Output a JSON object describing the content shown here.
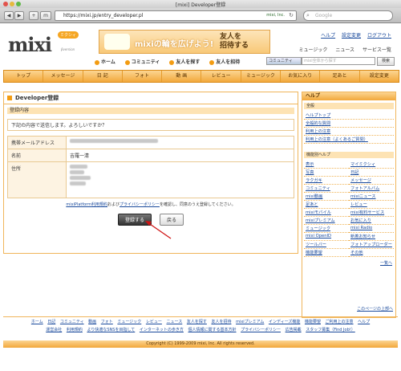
{
  "browser": {
    "title": "[mixi] Developer登録",
    "url": "https://mixi.jp/entry_developer.pl",
    "security": "mixi, Inc.",
    "search_placeholder": "Google"
  },
  "header": {
    "logo": "mixi",
    "logo_badge": "ミクシィ",
    "logo_beta": "βversion",
    "banner_text1": "mixiの輪を広げよう!",
    "banner_text2": "友人を\n招待する",
    "top_links": [
      "ヘルプ",
      "設定変更",
      "ログアウト"
    ],
    "services": [
      "ミュージック",
      "ニュース",
      "サービス一覧"
    ],
    "nav": [
      "ホーム",
      "コミュニティ",
      "友人を探す",
      "友人を招待"
    ],
    "community_select": "コミュニティ",
    "community_placeholder": "mixi全体から探す",
    "search_button": "検索"
  },
  "global_nav": [
    "トップ",
    "メッセージ",
    "日 記",
    "フォト",
    "動 画",
    "レビュー",
    "ミュージック",
    "お気に入り",
    "足あと",
    "設定変更"
  ],
  "main": {
    "title": "Developer登録",
    "section": "登録内容",
    "confirm": "下記の内容で送信します。よろしいですか？",
    "rows": [
      {
        "label": "携帯メールアドレス"
      },
      {
        "label": "名前",
        "value": "吉羅一清"
      },
      {
        "label": "住所"
      }
    ],
    "policy_link1": "mixiPlatform利用規約",
    "policy_mid": "および",
    "policy_link2": "プライバシーポリシー",
    "policy_tail": "を確認し、同意のうえ登録してください。",
    "register_button": "登録する",
    "back_button": "戻る"
  },
  "sidebar": {
    "title": "ヘルプ",
    "all_title": "全般",
    "all_items": [
      "ヘルプトップ",
      "全般的な質問",
      "利用上の注意",
      "利用上の注意（よくあるご質問）"
    ],
    "func_title": "機能別ヘルプ",
    "func_items": [
      "表示",
      "マイミクシィ",
      "写真",
      "日記",
      "ラクガキ",
      "メッセージ",
      "コミュニティ",
      "フォトアルバム",
      "mixi動画",
      "mixiニュース",
      "足あと",
      "レビュー",
      "mixiモバイル",
      "mixi有料サービス",
      "mixiプレミアム",
      "お気に入り",
      "ミュージック",
      "mixi Radio",
      "mixi OpenID",
      "新着お知らせ",
      "ツールバー",
      "フォトアップローダー",
      "機能要望",
      "その他"
    ],
    "more": "一覧へ"
  },
  "page_top": "このページの上部へ",
  "footer": {
    "row1": [
      "ホーム",
      "日記",
      "コミュニティ",
      "動画",
      "フォト",
      "ミュージック",
      "レビュー",
      "ニュース",
      "友人を探す",
      "友人を招待",
      "mixiプレミアム",
      "インディーズ機能",
      "機能要望",
      "ご利用上の注意",
      "ヘルプ"
    ],
    "row2": [
      "運営会社",
      "利用規約",
      "より快適なSNSを目指して",
      "インターネットの歩き方",
      "個人情報に関する基本方針",
      "プライバシーポリシー",
      "広告掲載",
      "スタッフ募集（Find Job!）"
    ],
    "copyright": "Copyright (C) 1999-2009 mixi, Inc. All rights reserved."
  }
}
